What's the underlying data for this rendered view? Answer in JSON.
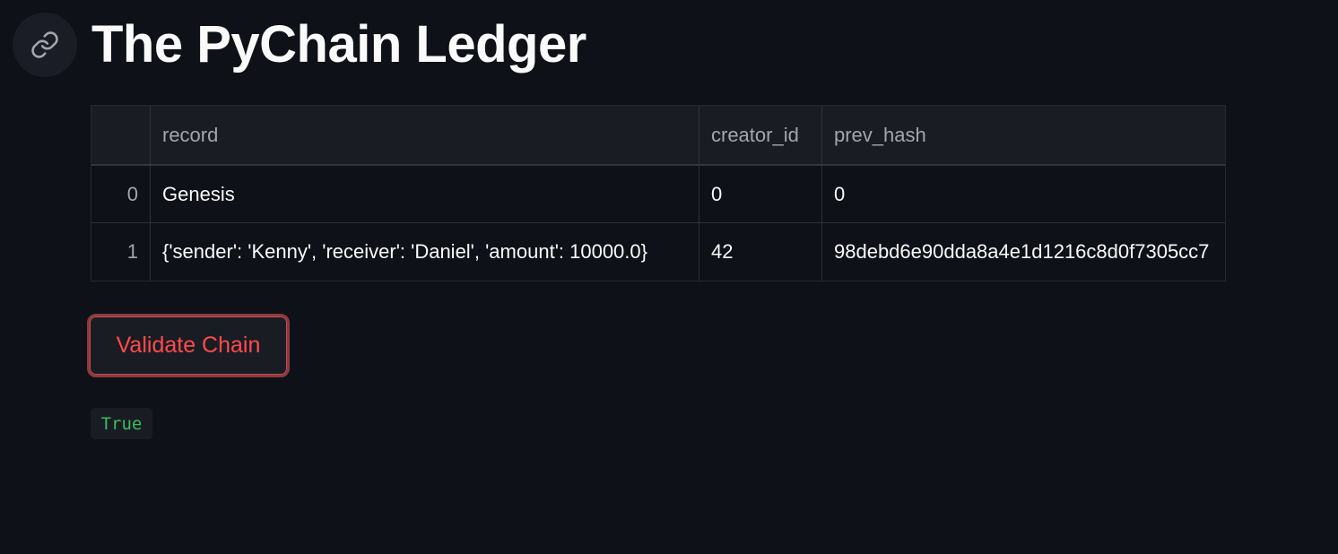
{
  "title": "The PyChain Ledger",
  "table": {
    "columns": [
      "",
      "record",
      "creator_id",
      "prev_hash"
    ],
    "rows": [
      {
        "index": "0",
        "record": "Genesis",
        "creator_id": "0",
        "prev_hash": "0"
      },
      {
        "index": "1",
        "record": "{'sender': 'Kenny', 'receiver': 'Daniel', 'amount': 10000.0}",
        "creator_id": "42",
        "prev_hash": "98debd6e90dda8a4e1d1216c8d0f7305cc7"
      }
    ]
  },
  "validate_button": "Validate Chain",
  "result": "True"
}
